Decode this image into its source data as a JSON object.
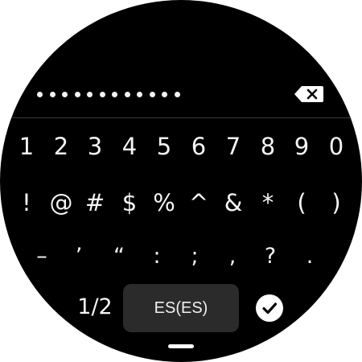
{
  "password_field": {
    "masked_length": 12
  },
  "keyboard": {
    "number_row": [
      "1",
      "2",
      "3",
      "4",
      "5",
      "6",
      "7",
      "8",
      "9",
      "0"
    ],
    "symbol_row": [
      "!",
      "@",
      "#",
      "$",
      "%",
      "^",
      "&",
      "*",
      "(",
      ")"
    ],
    "punct_row": [
      "–",
      "’",
      "“",
      ":",
      ";",
      ",",
      "?",
      "."
    ],
    "page_indicator": "1/2",
    "language_label": "ES(ES)"
  },
  "icons": {
    "backspace": "backspace-icon",
    "done": "checkmark-icon"
  },
  "colors": {
    "background": "#000000",
    "key_text": "#f5f5f5",
    "language_button_bg": "#2b2b2b"
  }
}
